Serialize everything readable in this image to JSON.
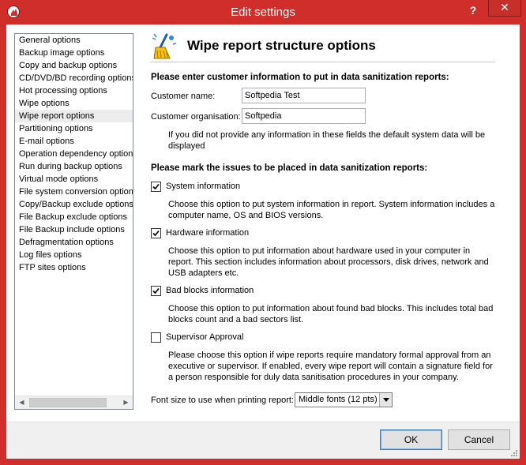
{
  "window": {
    "title": "Edit settings",
    "help_glyph": "?",
    "close_glyph": "✕"
  },
  "nav": {
    "items": [
      {
        "label": "General options"
      },
      {
        "label": "Backup image options"
      },
      {
        "label": "Copy and backup options"
      },
      {
        "label": "CD/DVD/BD recording options"
      },
      {
        "label": "Hot processing options"
      },
      {
        "label": "Wipe options"
      },
      {
        "label": "Wipe report options",
        "selected": true
      },
      {
        "label": "Partitioning options"
      },
      {
        "label": "E-mail options"
      },
      {
        "label": "Operation dependency options"
      },
      {
        "label": "Run during backup options"
      },
      {
        "label": "Virtual mode options"
      },
      {
        "label": "File system conversion options"
      },
      {
        "label": "Copy/Backup exclude options"
      },
      {
        "label": "File Backup exclude options"
      },
      {
        "label": "File Backup include options"
      },
      {
        "label": "Defragmentation options"
      },
      {
        "label": "Log files options"
      },
      {
        "label": "FTP sites options"
      }
    ],
    "scroll_left_glyph": "◀",
    "scroll_right_glyph": "▶"
  },
  "page": {
    "heading": "Wipe report structure options",
    "customer_section_title": "Please enter customer information to put in data sanitization reports:",
    "customer_name_label": "Customer name:",
    "customer_name_value": "Softpedia Test",
    "customer_org_label": "Customer organisation:",
    "customer_org_value": "Softpedia",
    "customer_note": "If you did not provide any information in these fields the default system data will be displayed",
    "issues_section_title": "Please mark the issues to be placed in data sanitization reports:",
    "options": [
      {
        "label": "System information",
        "checked": true,
        "description": "Choose this option to put system information in report. System information includes a computer name, OS and BIOS versions."
      },
      {
        "label": "Hardware information",
        "checked": true,
        "description": "Choose this option to put information about hardware used in your computer in report. This section includes information about processors, disk drives, network and USB adapters etc."
      },
      {
        "label": "Bad blocks information",
        "checked": true,
        "description": "Choose this option to put information about found bad blocks. This includes total bad blocks count and a bad sectors list."
      },
      {
        "label": "Supervisor Approval",
        "checked": false,
        "description": "Please choose this option if wipe reports require mandatory formal approval from an executive or supervisor. If enabled, every wipe report will contain a signature field for a person responsible for duly data sanitisation procedures in your company."
      }
    ],
    "font_size_label": "Font size to use when printing report:",
    "font_size_value": "Middle fonts (12 pts)"
  },
  "footer": {
    "ok_label": "OK",
    "cancel_label": "Cancel"
  },
  "colors": {
    "title_bar": "#cf2e2a",
    "selected_item": "#ececec"
  }
}
